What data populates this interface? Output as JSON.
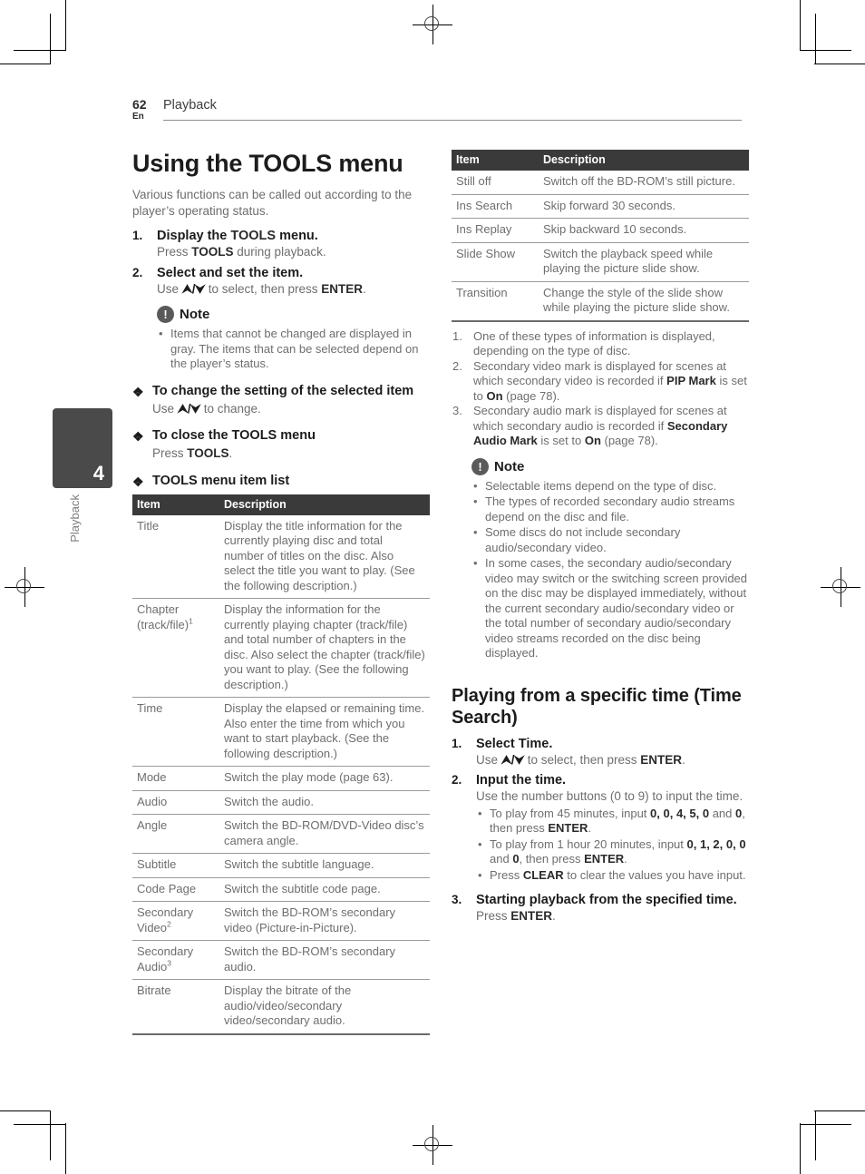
{
  "header": {
    "page_number": "62",
    "language": "En",
    "section": "Playback"
  },
  "chapter_tab": {
    "number": "4",
    "label": "Playback"
  },
  "left_column": {
    "title": "Using the TOOLS menu",
    "intro": "Various functions can be called out according to the player’s operating status.",
    "steps": [
      {
        "num": "1.",
        "head_before": "Display the ",
        "head_bold": "TOOLS",
        "head_after": " menu.",
        "body_before": "Press ",
        "body_bold": "TOOLS",
        "body_after": " during playback."
      },
      {
        "num": "2.",
        "head": "Select and set the item.",
        "body_before": "Use ",
        "arrows": "⮝/⮟",
        "body_mid": " to select, then press ",
        "body_bold": "ENTER",
        "body_after": "."
      }
    ],
    "note": {
      "icon": "exclamation-icon",
      "title": "Note",
      "bullets": [
        "Items that cannot be changed are displayed in gray. The items that can be selected depend on the player’s status."
      ]
    },
    "sections": [
      {
        "heading": "To change the setting of the selected item",
        "sub_before": "Use ",
        "arrows": "⮝/⮟",
        "sub_after": " to change."
      },
      {
        "heading": "To close the TOOLS menu",
        "sub_before": "Press ",
        "sub_bold": "TOOLS",
        "sub_after": "."
      },
      {
        "heading": "TOOLS menu item list"
      }
    ],
    "table": {
      "columns": [
        "Item",
        "Description"
      ],
      "rows": [
        {
          "item": "Title",
          "item_sup": "",
          "description": "Display the title information for the currently playing disc and total number of titles on the disc. Also select the title you want to play. (See the following description.)"
        },
        {
          "item": "Chapter (track/file)",
          "item_sup": "1",
          "description": "Display the information for the currently playing chapter (track/file) and total number of chapters in the disc. Also select the chapter (track/file) you want to play. (See the following description.)"
        },
        {
          "item": "Time",
          "item_sup": "",
          "description": "Display the elapsed or remaining time.\nAlso enter the time from which you want to start playback. (See the following description.)"
        },
        {
          "item": "Mode",
          "item_sup": "",
          "description": "Switch the play mode (page 63)."
        },
        {
          "item": "Audio",
          "item_sup": "",
          "description": "Switch the audio."
        },
        {
          "item": "Angle",
          "item_sup": "",
          "description": "Switch the BD-ROM/DVD-Video disc’s camera angle."
        },
        {
          "item": "Subtitle",
          "item_sup": "",
          "description": "Switch the subtitle language."
        },
        {
          "item": "Code Page",
          "item_sup": "",
          "description": "Switch the subtitle code page."
        },
        {
          "item": "Secondary Video",
          "item_sup": "2",
          "description": "Switch the BD-ROM’s secondary video (Picture-in-Picture)."
        },
        {
          "item": "Secondary Audio",
          "item_sup": "3",
          "description": "Switch the BD-ROM’s secondary audio."
        },
        {
          "item": "Bitrate",
          "item_sup": "",
          "description": "Display the bitrate of the audio/video/secondary video/secondary audio."
        }
      ]
    }
  },
  "right_column": {
    "table": {
      "columns": [
        "Item",
        "Description"
      ],
      "rows": [
        {
          "item": "Still off",
          "description": "Switch off the BD-ROM’s still picture."
        },
        {
          "item": "Ins Search",
          "description": "Skip forward 30 seconds."
        },
        {
          "item": "Ins Replay",
          "description": "Skip backward 10 seconds."
        },
        {
          "item": "Slide Show",
          "description": "Switch the playback speed while playing the picture slide show."
        },
        {
          "item": "Transition",
          "description": "Change the style of the slide show while playing the picture slide show."
        }
      ]
    },
    "footnotes": [
      {
        "num": "1.",
        "text": "One of these types of information is displayed, depending on the type of disc."
      },
      {
        "num": "2.",
        "prefix": "Secondary video mark is displayed for scenes at which secondary video is recorded if ",
        "bold1": "PIP Mark",
        "mid1": " is set to ",
        "bold2": "On",
        "suffix": " (page 78)."
      },
      {
        "num": "3.",
        "prefix": "Secondary audio mark is displayed for scenes at which secondary audio is recorded if ",
        "bold1": "Secondary Audio Mark",
        "mid1": " is set to ",
        "bold2": "On",
        "suffix": " (page 78)."
      }
    ],
    "note": {
      "icon": "exclamation-icon",
      "title": "Note",
      "bullets": [
        "Selectable items depend on the type of disc.",
        "The types of recorded secondary audio streams depend on the disc and file.",
        "Some discs do not include secondary audio/secondary video.",
        "In some cases, the secondary audio/secondary video may switch or the switching screen provided on the disc may be displayed immediately, without the current secondary audio/secondary video or the total number of secondary audio/secondary video streams recorded on the disc being displayed."
      ]
    },
    "title": "Playing from a specific time (Time Search)",
    "steps": [
      {
        "num": "1.",
        "head": "Select Time.",
        "body_before": "Use ",
        "arrows": "⮝/⮟",
        "body_mid": " to select, then press ",
        "body_bold": "ENTER",
        "body_after": "."
      },
      {
        "num": "2.",
        "head": "Input the time.",
        "body": "Use the number buttons (0 to 9) to input the time."
      },
      {
        "num": "3.",
        "head": "Starting playback from the specified time.",
        "body_before": "Press ",
        "body_bold": "ENTER",
        "body_after": "."
      }
    ],
    "input_bullets": [
      {
        "prefix": "To play from 45 minutes, input ",
        "values": "0, 0, 4, 5, 0",
        "mid": " and ",
        "last_value": "0",
        "mid2": ", then press ",
        "bold_key": "ENTER",
        "suffix": "."
      },
      {
        "prefix": "To play from 1 hour 20 minutes, input ",
        "values": "0, 1, 2, 0, 0",
        "mid": " and ",
        "last_value": "0",
        "mid2": ", then press ",
        "bold_key": "ENTER",
        "suffix": "."
      },
      {
        "prefix": "Press ",
        "bold_key": "CLEAR",
        "suffix": " to clear the values you have input."
      }
    ]
  },
  "colors": {
    "table_header_bg": "#3a3a3a",
    "chapter_tab_bg": "#4a4a4a",
    "body_text": "#6e6e6e",
    "heading_text": "#1c1c1c"
  }
}
